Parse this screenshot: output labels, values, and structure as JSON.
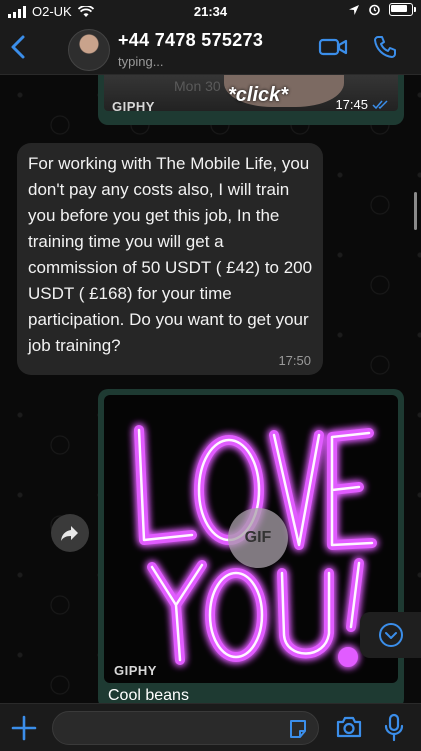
{
  "status_bar": {
    "carrier": "O2-UK",
    "time": "21:34"
  },
  "header": {
    "contact_name": "+44 7478 575273",
    "contact_status": "typing..."
  },
  "messages": {
    "gif_top": {
      "overlay_text": "*click*",
      "background_text": "Mon 30",
      "source": "GIPHY",
      "time": "17:45"
    },
    "incoming": {
      "text": "For working with The Mobile Life, you don't pay any costs also, I will train you before you get this job, In the training time you will get a commission of 50 USDT ( £42) to 200 USDT ( £168) for your time participation. Do you want to get your job training?",
      "time": "17:50"
    },
    "gif_love": {
      "art_text": "LOVE YOU!",
      "badge": "GIF",
      "source": "GIPHY",
      "caption": "Cool beans"
    }
  },
  "composer": {
    "placeholder": ""
  },
  "colors": {
    "accent": "#3b8eea",
    "outgoing_bubble": "#1e3a32",
    "incoming_bubble": "#262626",
    "neon_pink": "#e15cff"
  }
}
